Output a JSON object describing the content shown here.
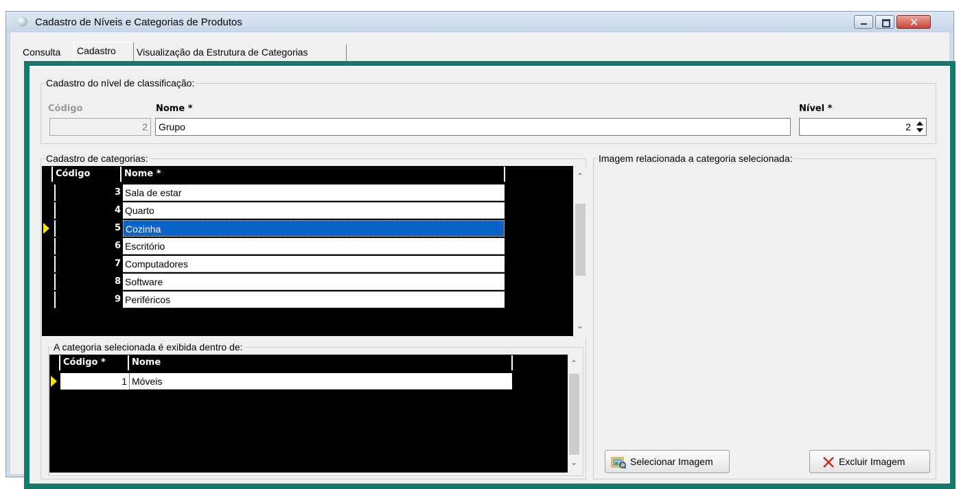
{
  "window": {
    "title": "Cadastro de Níveis e Categorias de Produtos",
    "close_glyph": "✕"
  },
  "tabs": [
    {
      "label": "Consulta"
    },
    {
      "label": "Cadastro"
    },
    {
      "label": "Visualização da Estrutura de Categorias"
    }
  ],
  "nivel_group": {
    "title": "Cadastro do nível de classificação:",
    "codigo_label": "Código",
    "codigo_value": "2",
    "nome_label": "Nome *",
    "nome_value": "Grupo",
    "nivel_label": "Nível *",
    "nivel_value": "2"
  },
  "categorias_group": {
    "title": "Cadastro de categorias:",
    "columns": [
      "Código",
      "Nome *"
    ],
    "rows": [
      {
        "code": "3",
        "name": "Sala de estar"
      },
      {
        "code": "4",
        "name": "Quarto"
      },
      {
        "code": "5",
        "name": "Cozinha"
      },
      {
        "code": "6",
        "name": "Escritório"
      },
      {
        "code": "7",
        "name": "Computadores"
      },
      {
        "code": "8",
        "name": "Software"
      },
      {
        "code": "9",
        "name": "Periféricos"
      }
    ],
    "selected_code": "5"
  },
  "pai_group": {
    "title": "A categoria selecionada é exibida dentro de:",
    "columns": [
      "Código *",
      "Nome"
    ],
    "rows": [
      {
        "code": "1",
        "name": "Móveis"
      }
    ]
  },
  "imagem_group": {
    "title": "Imagem relacionada a categoria selecionada:",
    "select_button": "Selecionar Imagem",
    "delete_button": "Excluir Imagem",
    "select_icon": "image-folder-icon",
    "delete_icon": "red-x-icon"
  },
  "scroll": {
    "up": "⌃",
    "down": "⌄"
  },
  "colors": {
    "frame": "#137a6d",
    "selection": "#0a64c8",
    "row_indicator": "#ffe800",
    "grid_bg": "#000000"
  }
}
